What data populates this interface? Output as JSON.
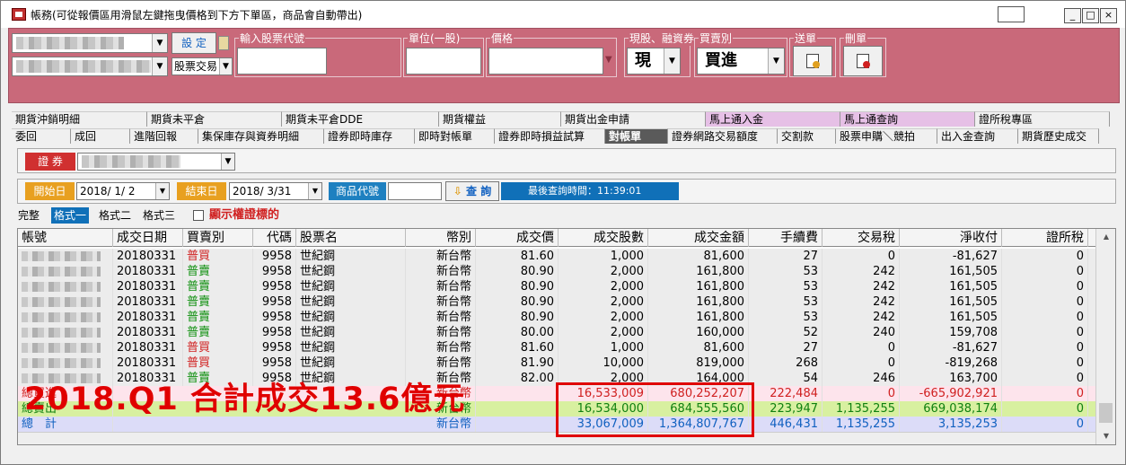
{
  "window": {
    "title": "帳務(可從報價區用滑鼠左鍵拖曳價格到下方下單區，商品會自動帶出)",
    "extra_btn": "",
    "min": "_",
    "max": "□",
    "close": "×"
  },
  "order_panel": {
    "settings_btn": "設 定",
    "trade_type": "股票交易",
    "groups": {
      "stock_code": "輸入股票代號",
      "unit": "單位(一股)",
      "price": "價格",
      "cash_margin": "現股、融資券",
      "buy_sell": "買賣別",
      "send": "送單",
      "delete": "刪單"
    },
    "cash_value": "現",
    "buysell_value": "買進"
  },
  "tabs_row1": [
    {
      "label": "期貨沖銷明細",
      "w": 151
    },
    {
      "label": "期貨未平倉",
      "w": 150
    },
    {
      "label": "期貨未平倉DDE",
      "w": 175
    },
    {
      "label": "期貨權益",
      "w": 136
    },
    {
      "label": "期貨出金申請",
      "w": 161
    },
    {
      "label": "馬上通入金",
      "w": 150,
      "pink": true
    },
    {
      "label": "馬上通查詢",
      "w": 150,
      "pink": true
    },
    {
      "label": "證所稅專區",
      "w": 150
    }
  ],
  "tabs_row2": [
    {
      "label": "委回",
      "w": 66
    },
    {
      "label": "成回",
      "w": 66
    },
    {
      "label": "進階回報",
      "w": 76
    },
    {
      "label": "集保庫存與資券明細",
      "w": 140
    },
    {
      "label": "證券即時庫存",
      "w": 101
    },
    {
      "label": "即時對帳單",
      "w": 89
    },
    {
      "label": "證券即時損益試算",
      "w": 123
    },
    {
      "label": "對帳單",
      "w": 70,
      "active": true
    },
    {
      "label": "證券網路交易額度",
      "w": 122
    },
    {
      "label": "交割款",
      "w": 65
    },
    {
      "label": "股票申購＼競拍",
      "w": 113
    },
    {
      "label": "出入金查詢",
      "w": 90
    },
    {
      "label": "期貨歷史成交",
      "w": 90
    }
  ],
  "filter": {
    "category_label": "證 券",
    "start_label": "開始日",
    "start_date": "2018/ 1/ 2",
    "end_label": "結束日",
    "end_date": "2018/ 3/31",
    "product_label": "商品代號",
    "query_btn": "查 詢",
    "last_query": "最後查詢時間：11:39:01"
  },
  "formats": {
    "complete": "完整",
    "f1": "格式一",
    "f2": "格式二",
    "f3": "格式三",
    "show_warrant": "顯示權證標的"
  },
  "table": {
    "headers": [
      "帳號",
      "成交日期",
      "買賣別",
      "代碼",
      "股票名",
      "幣別",
      "成交價",
      "成交股數",
      "成交金額",
      "手續費",
      "交易稅",
      "淨收付",
      "證所稅"
    ],
    "rows": [
      {
        "date": "20180331",
        "side": "普買",
        "code": "9958",
        "name": "世紀鋼",
        "cur": "新台幣",
        "price": "81.60",
        "qty": "1,000",
        "amt": "81,600",
        "fee": "27",
        "tax": "0",
        "net": "-81,627",
        "ctax": "0"
      },
      {
        "date": "20180331",
        "side": "普賣",
        "code": "9958",
        "name": "世紀鋼",
        "cur": "新台幣",
        "price": "80.90",
        "qty": "2,000",
        "amt": "161,800",
        "fee": "53",
        "tax": "242",
        "net": "161,505",
        "ctax": "0"
      },
      {
        "date": "20180331",
        "side": "普賣",
        "code": "9958",
        "name": "世紀鋼",
        "cur": "新台幣",
        "price": "80.90",
        "qty": "2,000",
        "amt": "161,800",
        "fee": "53",
        "tax": "242",
        "net": "161,505",
        "ctax": "0"
      },
      {
        "date": "20180331",
        "side": "普賣",
        "code": "9958",
        "name": "世紀鋼",
        "cur": "新台幣",
        "price": "80.90",
        "qty": "2,000",
        "amt": "161,800",
        "fee": "53",
        "tax": "242",
        "net": "161,505",
        "ctax": "0"
      },
      {
        "date": "20180331",
        "side": "普賣",
        "code": "9958",
        "name": "世紀鋼",
        "cur": "新台幣",
        "price": "80.90",
        "qty": "2,000",
        "amt": "161,800",
        "fee": "53",
        "tax": "242",
        "net": "161,505",
        "ctax": "0"
      },
      {
        "date": "20180331",
        "side": "普賣",
        "code": "9958",
        "name": "世紀鋼",
        "cur": "新台幣",
        "price": "80.00",
        "qty": "2,000",
        "amt": "160,000",
        "fee": "52",
        "tax": "240",
        "net": "159,708",
        "ctax": "0"
      },
      {
        "date": "20180331",
        "side": "普買",
        "code": "9958",
        "name": "世紀鋼",
        "cur": "新台幣",
        "price": "81.60",
        "qty": "1,000",
        "amt": "81,600",
        "fee": "27",
        "tax": "0",
        "net": "-81,627",
        "ctax": "0"
      },
      {
        "date": "20180331",
        "side": "普買",
        "code": "9958",
        "name": "世紀鋼",
        "cur": "新台幣",
        "price": "81.90",
        "qty": "10,000",
        "amt": "819,000",
        "fee": "268",
        "tax": "0",
        "net": "-819,268",
        "ctax": "0"
      },
      {
        "date": "20180331",
        "side": "普賣",
        "code": "9958",
        "name": "世紀鋼",
        "cur": "新台幣",
        "price": "82.00",
        "qty": "2,000",
        "amt": "164,000",
        "fee": "54",
        "tax": "246",
        "net": "163,700",
        "ctax": "0"
      }
    ],
    "totals": [
      {
        "label": "總買進",
        "cur": "新台幣",
        "qty": "16,533,009",
        "amt": "680,252,207",
        "fee": "222,484",
        "tax": "0",
        "net": "-665,902,921",
        "ctax": "0",
        "bg": "#fde4ec",
        "color": "#d02020"
      },
      {
        "label": "總賣出",
        "cur": "新台幣",
        "qty": "16,534,000",
        "amt": "684,555,560",
        "fee": "223,947",
        "tax": "1,135,255",
        "net": "669,038,174",
        "ctax": "0",
        "bg": "#d8f0a0",
        "color": "#108010"
      },
      {
        "label": "總　計",
        "cur": "新台幣",
        "qty": "33,067,009",
        "amt": "1,364,807,767",
        "fee": "446,431",
        "tax": "1,135,255",
        "net": "3,135,253",
        "ctax": "0",
        "bg": "#dcdcf8",
        "color": "#1060c0"
      }
    ]
  },
  "annotation": "2018.Q1 合計成交13.6億元",
  "colors": {
    "panel": "#c9697a",
    "buy": "#d02020",
    "sell": "#109010"
  }
}
